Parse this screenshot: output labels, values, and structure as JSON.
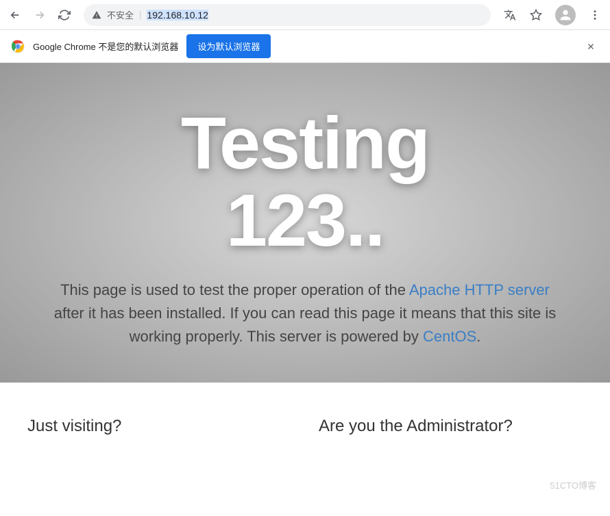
{
  "toolbar": {
    "not_secure_label": "不安全",
    "url_ip": "192.168.10.12"
  },
  "infobar": {
    "message": "Google Chrome 不是您的默认浏览器",
    "set_default_button": "设为默认浏览器"
  },
  "hero": {
    "title_line1": "Testing",
    "title_line2": "123..",
    "desc_part1": "This page is used to test the proper operation of the ",
    "desc_link1": "Apache HTTP server",
    "desc_part2": " after it has been installed. If you can read this page it means that this site is working properly. This server is powered by ",
    "desc_link2": "CentOS",
    "desc_part3": "."
  },
  "columns": {
    "left_heading": "Just visiting?",
    "right_heading": "Are you the Administrator?"
  },
  "watermark": "51CTO博客"
}
